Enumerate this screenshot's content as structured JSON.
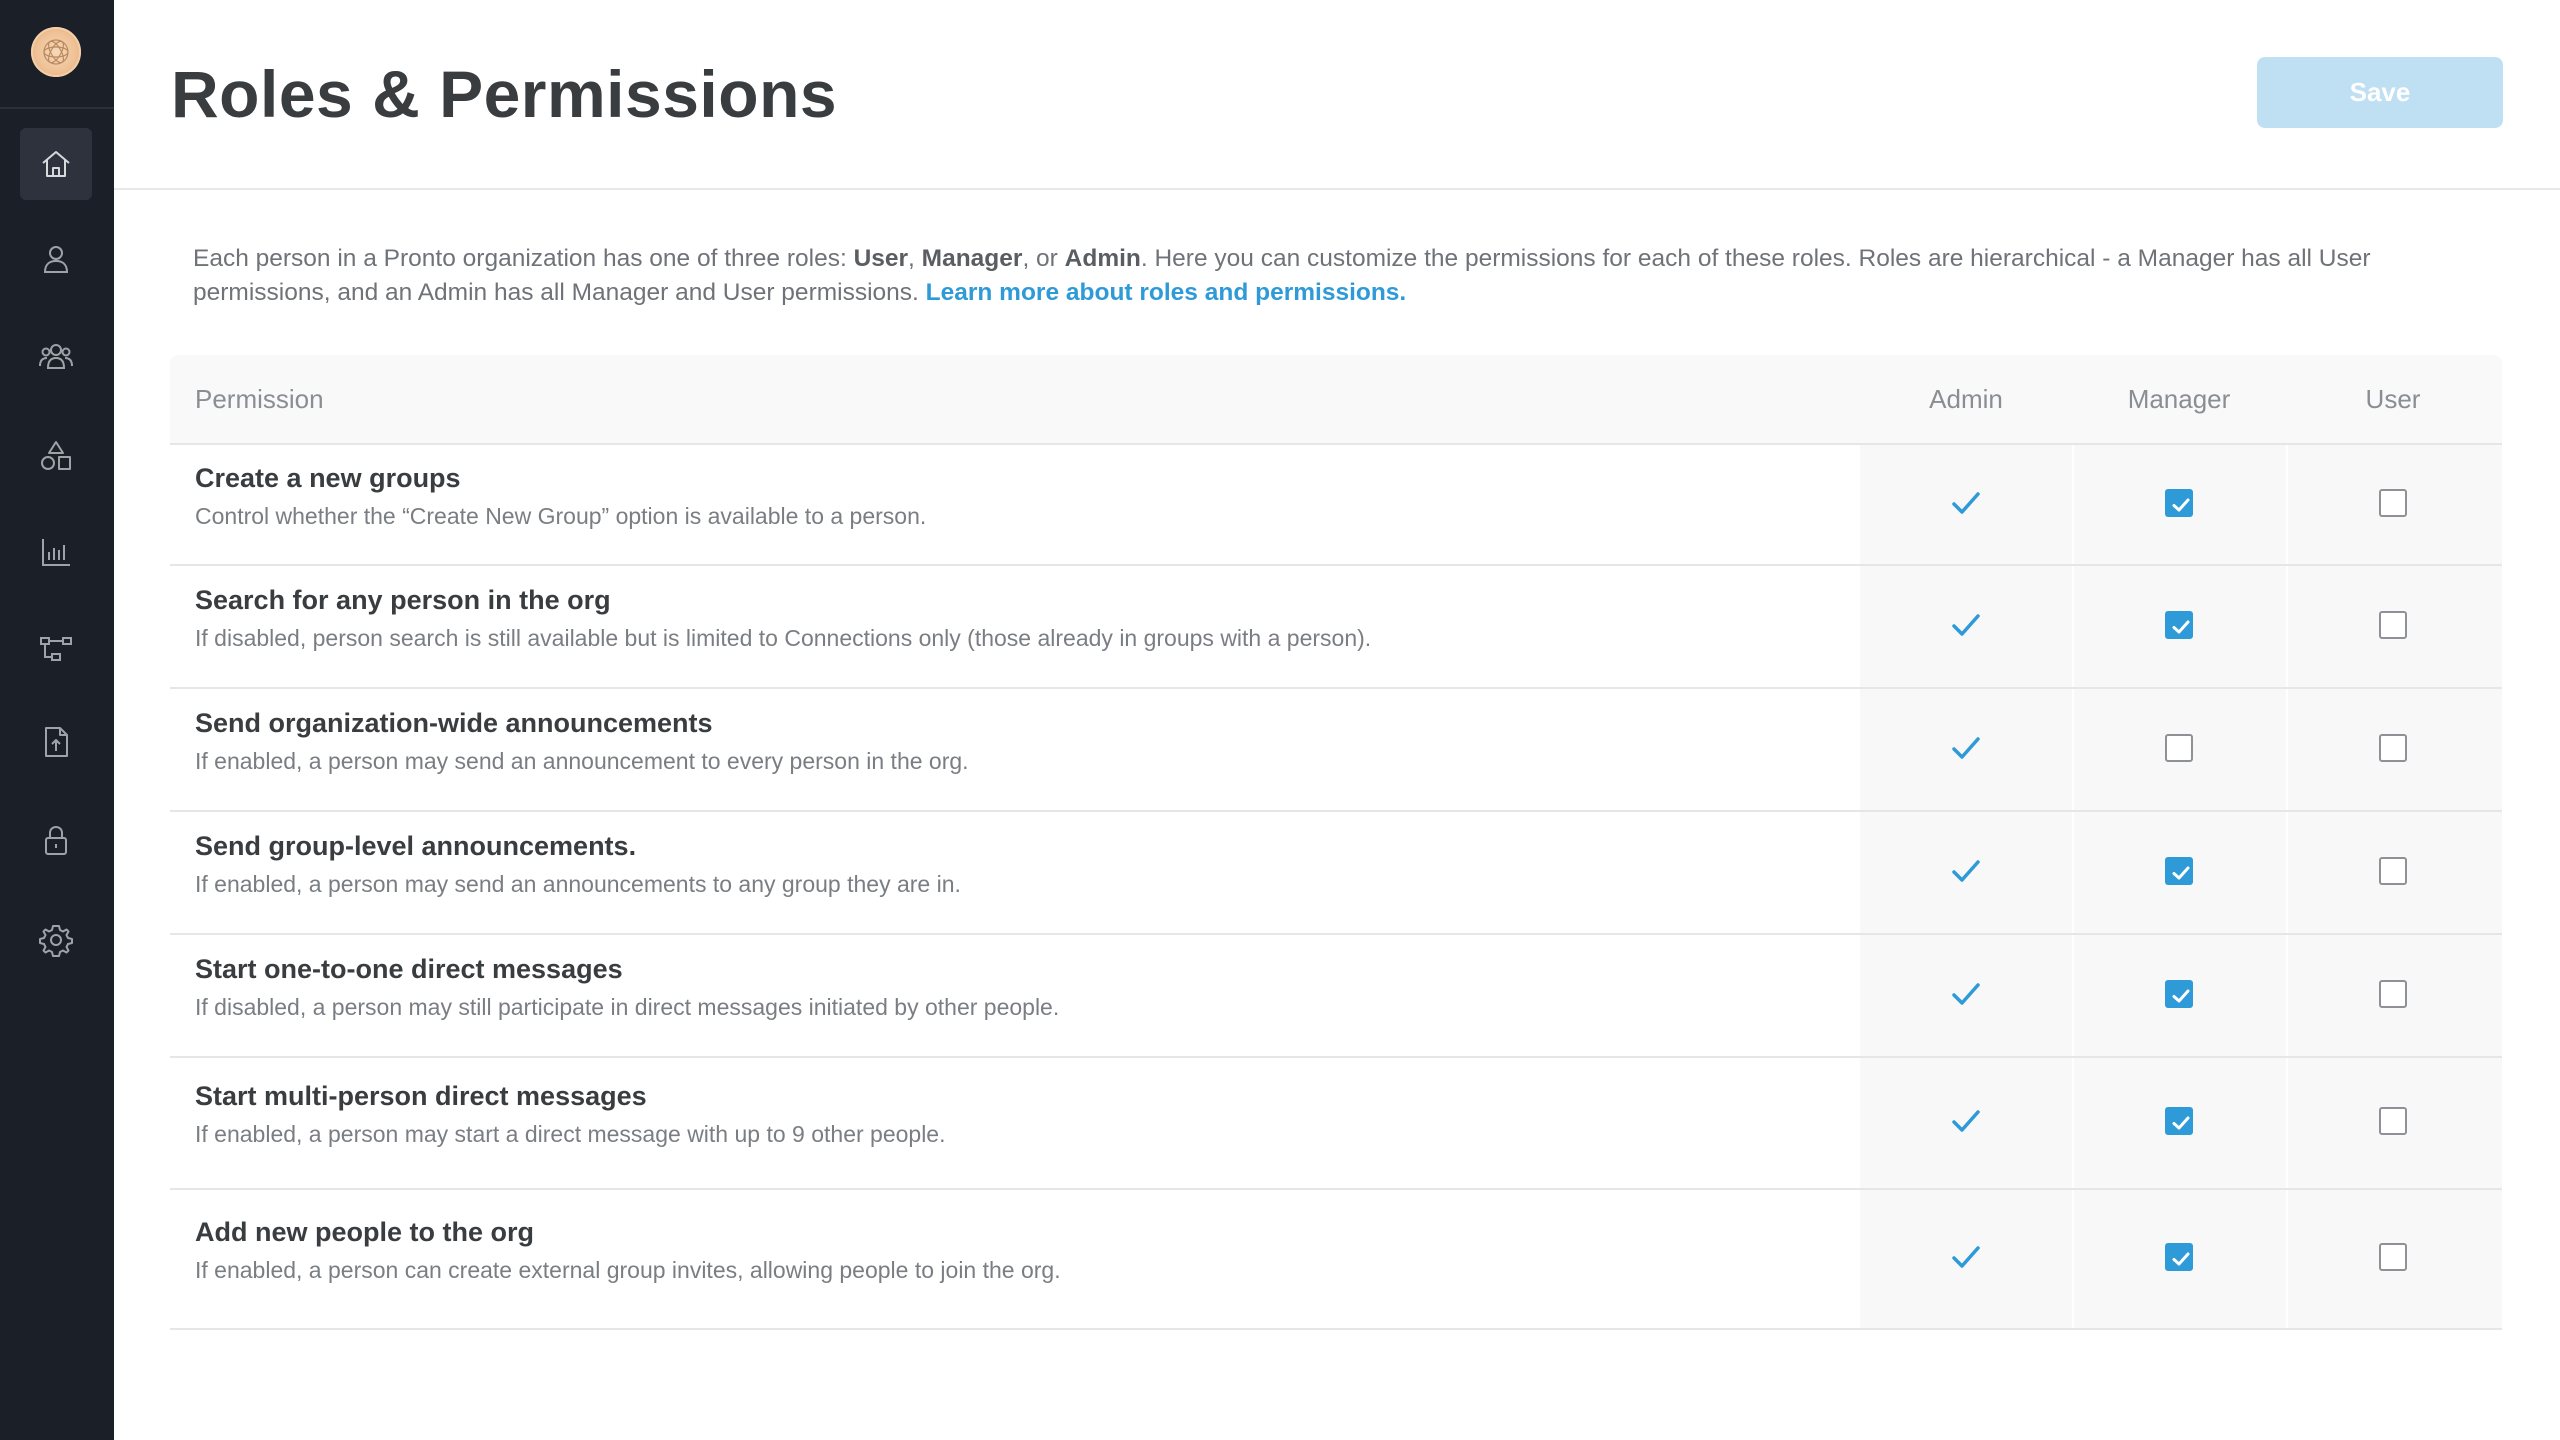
{
  "colors": {
    "sidebar": "#1b1f27",
    "accent": "#2e9ad8",
    "save_disabled": "#bfe0f2"
  },
  "sidebar": {
    "items": [
      {
        "icon": "home-icon",
        "active": true
      },
      {
        "icon": "person-icon",
        "active": false
      },
      {
        "icon": "people-group-icon",
        "active": false
      },
      {
        "icon": "shapes-icon",
        "active": false
      },
      {
        "icon": "bar-chart-icon",
        "active": false
      },
      {
        "icon": "hierarchy-icon",
        "active": false
      },
      {
        "icon": "upload-document-icon",
        "active": false
      },
      {
        "icon": "lock-icon",
        "active": false
      },
      {
        "icon": "gear-icon",
        "active": false
      }
    ]
  },
  "header": {
    "title": "Roles & Permissions",
    "save_label": "Save"
  },
  "intro": {
    "part1": "Each person in a Pronto organization has one of three roles: ",
    "role_user": "User",
    "sep1": ", ",
    "role_manager": "Manager",
    "sep2": ", or ",
    "role_admin": "Admin",
    "part2": ". Here you can customize the permissions for each of these roles. Roles are hierarchical - a Manager has all User permissions, and an Admin has all Manager and User permissions. ",
    "link": "Learn more about roles and permissions."
  },
  "table": {
    "headers": {
      "permission": "Permission",
      "admin": "Admin",
      "manager": "Manager",
      "user": "User"
    },
    "rows": [
      {
        "title": "Create a new groups",
        "description": "Control whether the “Create New Group” option is available to a person.",
        "admin": true,
        "manager": true,
        "user": false
      },
      {
        "title": "Search for any person in the org",
        "description": "If disabled, person search is still available but is limited to Connections only (those already in groups with a person).",
        "admin": true,
        "manager": true,
        "user": false
      },
      {
        "title": "Send organization-wide announcements",
        "description": "If enabled, a person may send an announcement to every person in the org.",
        "admin": true,
        "manager": false,
        "user": false
      },
      {
        "title": "Send group-level announcements.",
        "description": "If enabled, a person may send an announcements to any group they are in.",
        "admin": true,
        "manager": true,
        "user": false
      },
      {
        "title": "Start one-to-one direct messages",
        "description": "If disabled, a person may still participate in direct messages initiated by other people.",
        "admin": true,
        "manager": true,
        "user": false
      },
      {
        "title": "Start multi-person direct messages",
        "description": "If enabled, a person may start a direct message with up to 9 other people.",
        "admin": true,
        "manager": true,
        "user": false
      },
      {
        "title": "Add new people to the org",
        "description": "If enabled, a person can create external group invites, allowing people to join the org.",
        "admin": true,
        "manager": true,
        "user": false
      }
    ]
  }
}
